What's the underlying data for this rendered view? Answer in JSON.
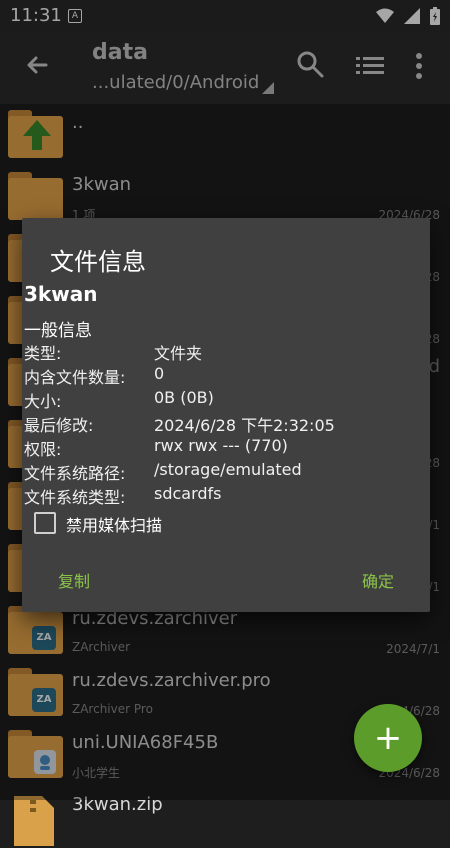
{
  "status": {
    "time": "11:31",
    "a_icon": "A"
  },
  "toolbar": {
    "title": "data",
    "path": "...ulated/0/Android"
  },
  "files": [
    {
      "name": "..",
      "sub": "",
      "date": ""
    },
    {
      "name": "3kwan",
      "sub": "1 项",
      "date": "2024/6/28"
    },
    {
      "name": "",
      "sub": "",
      "date": "28"
    },
    {
      "name": "",
      "sub": "",
      "date": "28"
    },
    {
      "name": "",
      "sub": "",
      "date": "d"
    },
    {
      "name": "",
      "sub": "",
      "date": "28"
    },
    {
      "name": "",
      "sub": "",
      "date": "/1"
    },
    {
      "name": "",
      "sub": "",
      "date": "/1"
    },
    {
      "name": "ru.zdevs.zarchiver",
      "sub": "ZArchiver",
      "date": "2024/7/1",
      "badge": "ZA"
    },
    {
      "name": "ru.zdevs.zarchiver.pro",
      "sub": "ZArchiver Pro",
      "date": "2024/6/28",
      "badge": "ZA"
    },
    {
      "name": "uni.UNIA68F45B",
      "sub": "小北学生",
      "date": "2024/6/28"
    },
    {
      "name": "3kwan.zip",
      "sub": "",
      "date": ""
    }
  ],
  "dialog": {
    "title": "文件信息",
    "name": "3kwan",
    "section": "一般信息",
    "rows": [
      {
        "label": "类型:",
        "value": "文件夹"
      },
      {
        "label": "内含文件数量:",
        "value": "0"
      },
      {
        "label": "大小:",
        "value": "0B (0B)"
      },
      {
        "label": "最后修改:",
        "value": "2024/6/28 下午2:32:05"
      },
      {
        "label": "权限:",
        "value": "rwx rwx --- (770)"
      },
      {
        "label": "文件系统路径:",
        "value": "/storage/emulated"
      },
      {
        "label": "文件系统类型:",
        "value": "sdcardfs"
      }
    ],
    "checkbox_label": "禁用媒体扫描",
    "copy_label": "复制",
    "ok_label": "确定"
  },
  "fab": {
    "label": "+"
  },
  "colors": {
    "accent": "#8bc34a",
    "fab": "#5b9c2b",
    "folder": "#e8a64b",
    "dialog_bg": "#404040"
  }
}
